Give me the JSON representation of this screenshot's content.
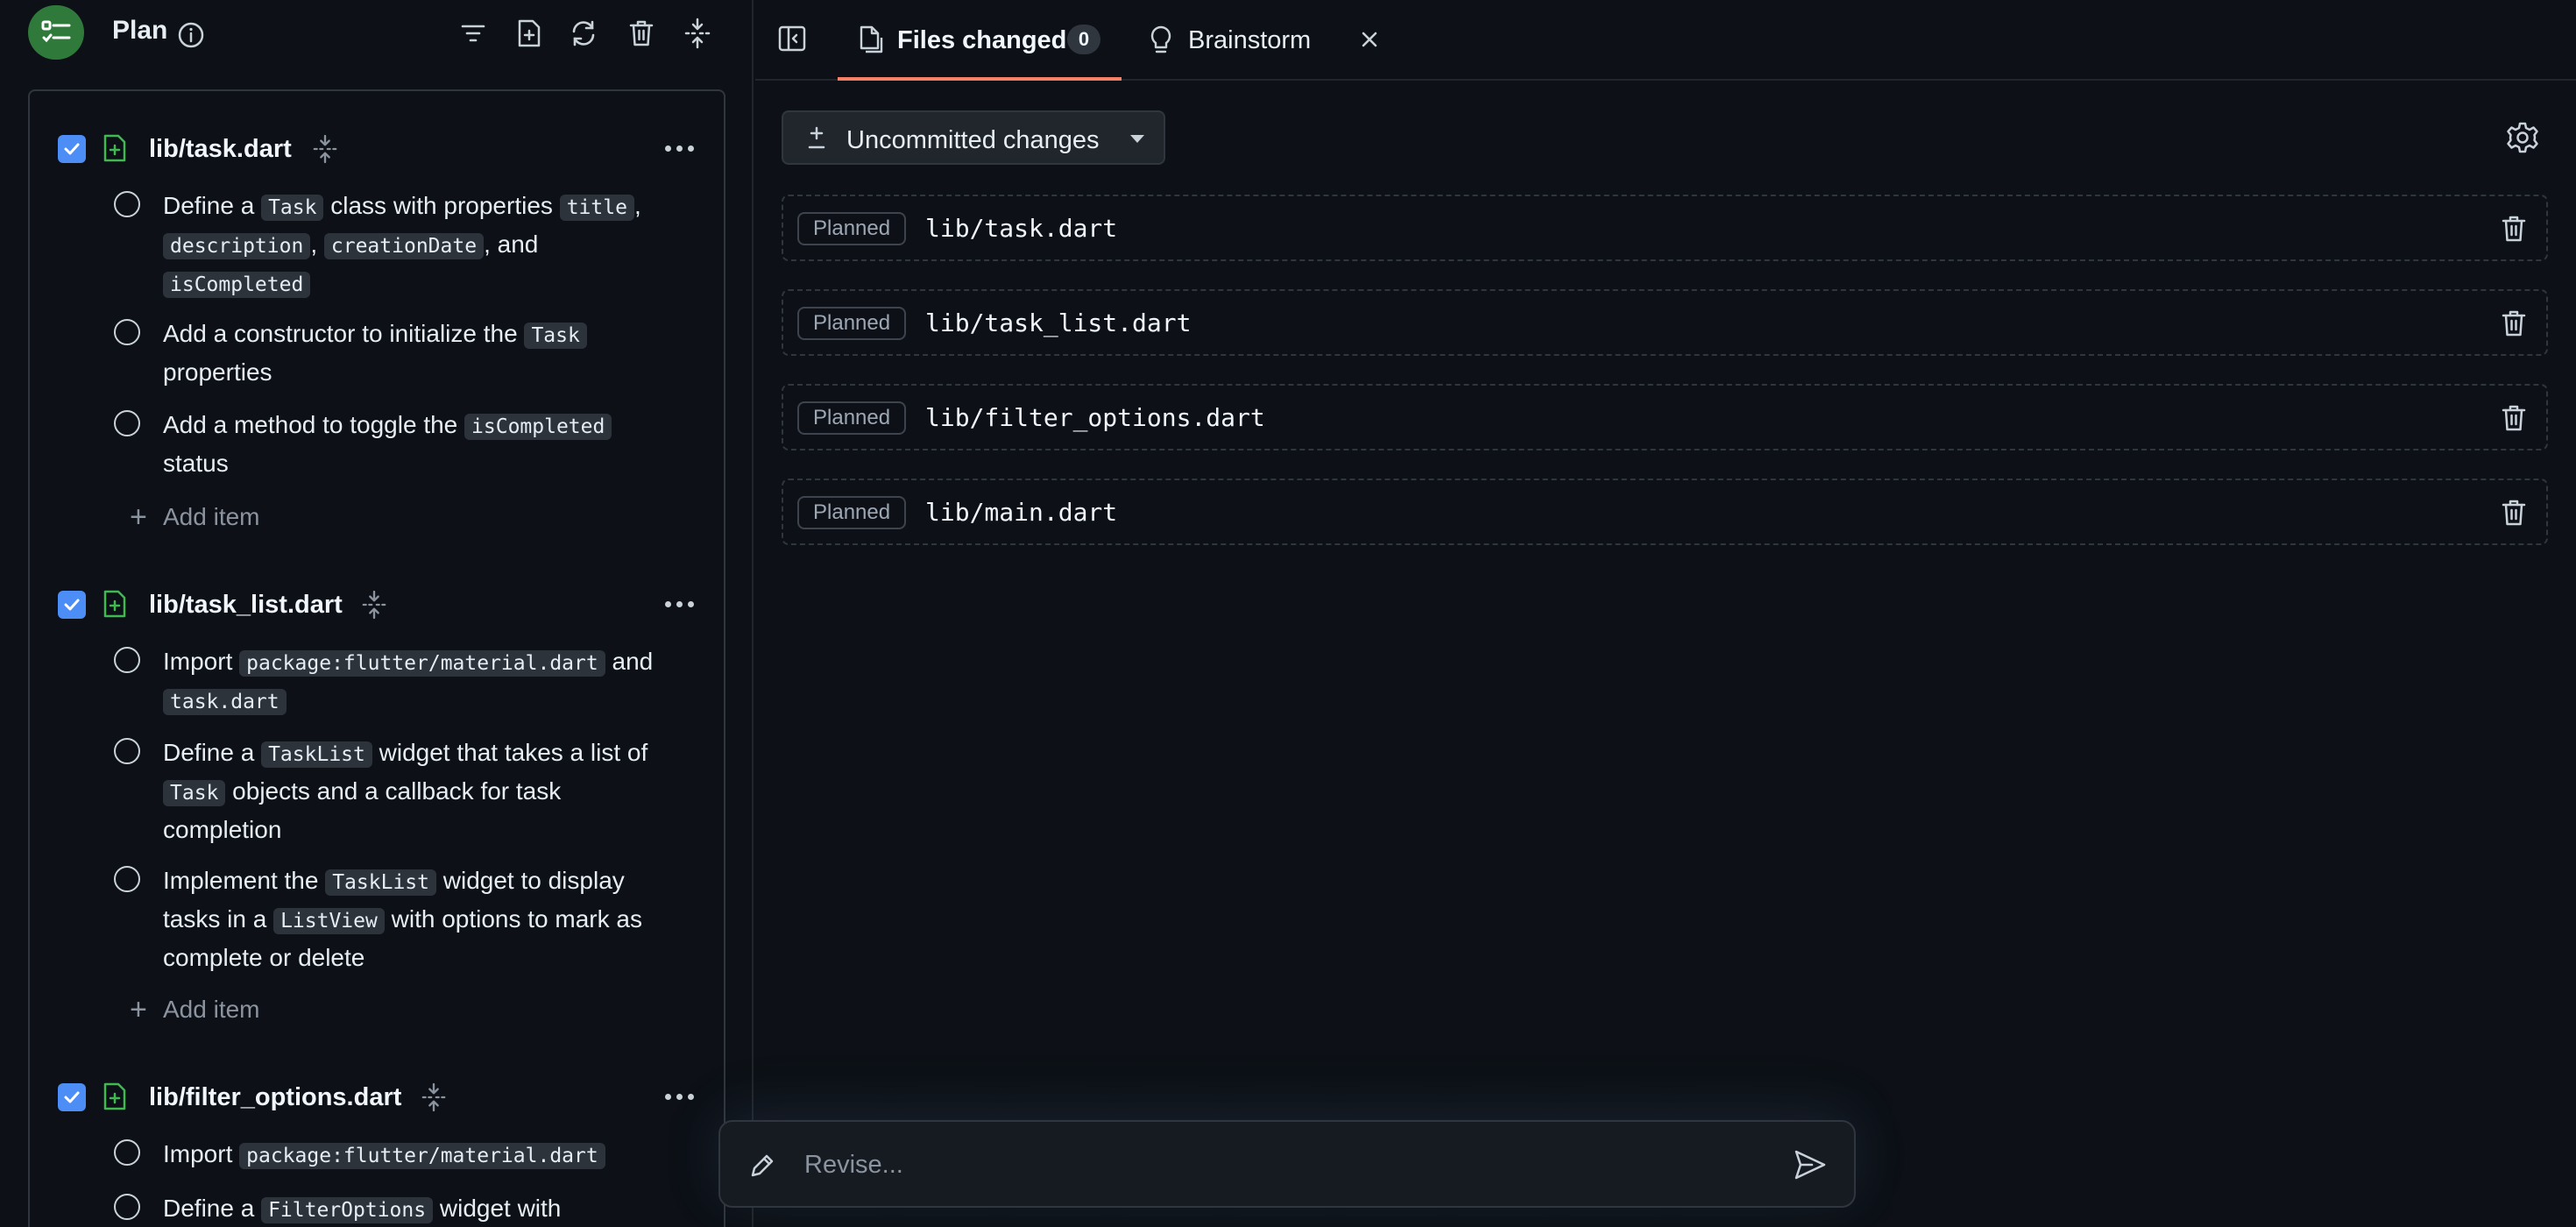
{
  "plan": {
    "title": "Plan",
    "sections": [
      {
        "file": "lib/task.dart",
        "items": [
          [
            {
              "t": "Define a "
            },
            {
              "c": "Task"
            },
            {
              "t": " class with properties "
            },
            {
              "c": "title"
            },
            {
              "t": ", "
            },
            {
              "c": "description"
            },
            {
              "t": ", "
            },
            {
              "c": "creationDate"
            },
            {
              "t": ", and "
            },
            {
              "c": "isCompleted"
            }
          ],
          [
            {
              "t": "Add a constructor to initialize the "
            },
            {
              "c": "Task"
            },
            {
              "t": " properties"
            }
          ],
          [
            {
              "t": "Add a method to toggle the "
            },
            {
              "c": "isCompleted"
            },
            {
              "t": " status"
            }
          ]
        ],
        "add_label": "Add item"
      },
      {
        "file": "lib/task_list.dart",
        "items": [
          [
            {
              "t": "Import "
            },
            {
              "c": "package:flutter/material.dart"
            },
            {
              "t": " and "
            },
            {
              "c": "task.dart"
            }
          ],
          [
            {
              "t": "Define a "
            },
            {
              "c": "TaskList"
            },
            {
              "t": " widget that takes a list of "
            },
            {
              "c": "Task"
            },
            {
              "t": " objects and a callback for task completion"
            }
          ],
          [
            {
              "t": "Implement the "
            },
            {
              "c": "TaskList"
            },
            {
              "t": " widget to display tasks in a "
            },
            {
              "c": "ListView"
            },
            {
              "t": " with options to mark as complete or delete"
            }
          ]
        ],
        "add_label": "Add item"
      },
      {
        "file": "lib/filter_options.dart",
        "items": [
          [
            {
              "t": "Import "
            },
            {
              "c": "package:flutter/material.dart"
            }
          ],
          [
            {
              "t": "Define a "
            },
            {
              "c": "FilterOptions"
            },
            {
              "t": " widget with"
            }
          ]
        ]
      }
    ]
  },
  "tabs": {
    "files_changed": {
      "label": "Files changed",
      "count": "0"
    },
    "brainstorm": {
      "label": "Brainstorm"
    }
  },
  "changes": {
    "dropdown_label": "Uncommitted changes",
    "badge": "Planned",
    "files": [
      "lib/task.dart",
      "lib/task_list.dart",
      "lib/filter_options.dart",
      "lib/main.dart"
    ]
  },
  "revise": {
    "placeholder": "Revise..."
  },
  "colors": {
    "accent": "#4c8df6",
    "tab_underline": "#f78166",
    "app_badge": "#2f7a3a",
    "file_add": "#3fb950"
  }
}
